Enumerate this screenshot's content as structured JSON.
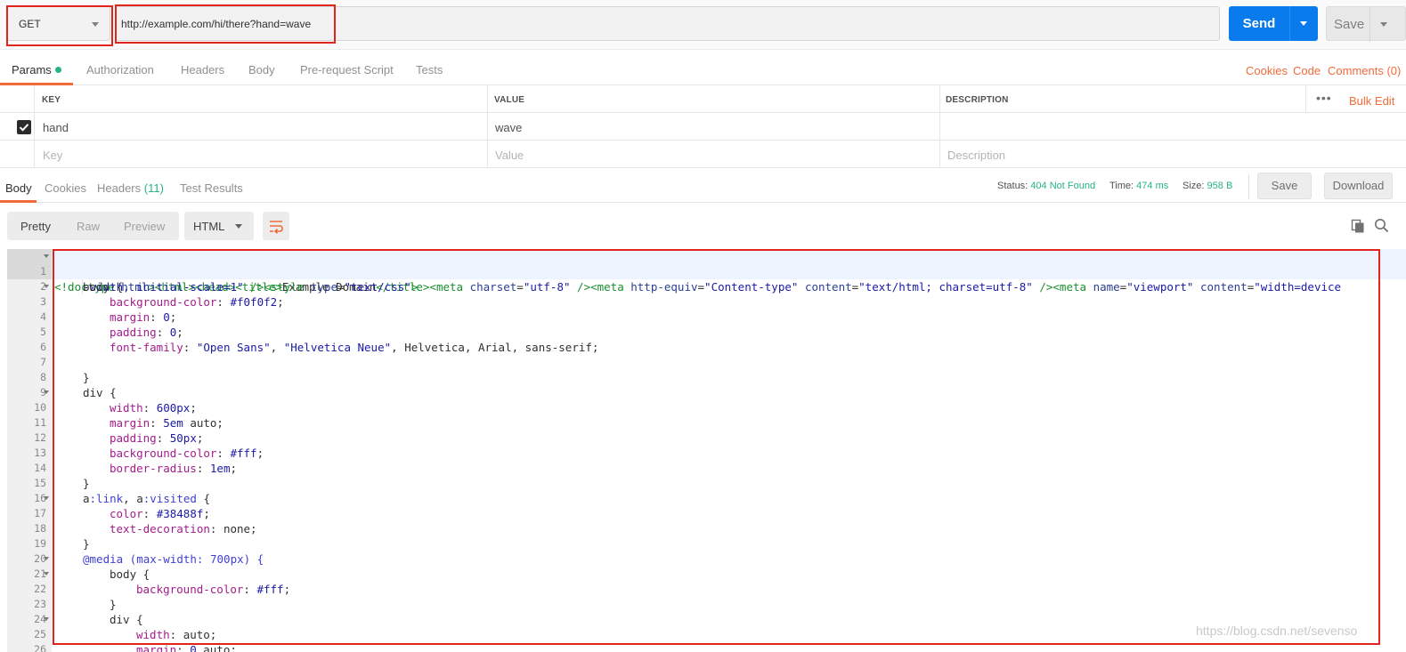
{
  "request": {
    "method": "GET",
    "url": "http://example.com/hi/there?hand=wave",
    "send_label": "Send",
    "save_label": "Save"
  },
  "request_tabs": {
    "params": "Params",
    "authorization": "Authorization",
    "headers": "Headers",
    "body": "Body",
    "prerequest": "Pre-request Script",
    "tests": "Tests",
    "cookies": "Cookies",
    "code": "Code",
    "comments": "Comments (0)"
  },
  "params": {
    "headers": {
      "key": "KEY",
      "value": "VALUE",
      "description": "DESCRIPTION"
    },
    "bulk_edit": "Bulk Edit",
    "more": "•••",
    "rows": [
      {
        "key": "hand",
        "value": "wave",
        "description": "",
        "enabled": true
      }
    ],
    "placeholders": {
      "key": "Key",
      "value": "Value",
      "description": "Description"
    }
  },
  "response_tabs": {
    "body": "Body",
    "cookies": "Cookies",
    "headers": "Headers",
    "headers_count": "(11)",
    "test_results": "Test Results"
  },
  "response_status": {
    "status_label": "Status:",
    "status_value": "404 Not Found",
    "time_label": "Time:",
    "time_value": "474 ms",
    "size_label": "Size:",
    "size_value": "958 B",
    "save_label": "Save",
    "download_label": "Download"
  },
  "view_modes": {
    "pretty": "Pretty",
    "raw": "Raw",
    "preview": "Preview",
    "format": "HTML"
  },
  "code": {
    "l1a": "<!doctype html><html><head><title>Example Domain</title><meta charset=\"utf-8\" /><meta http-equiv=\"Content-type\" content=\"text/html; charset=utf-8\" /><meta name=\"viewport\" content=\"width=device",
    "l1b": "-width, initial-scale=1\" /><style type=\"text/css\">",
    "l2": "body {",
    "l3": "background-color: #f0f0f2;",
    "l4": "margin: 0;",
    "l5": "padding: 0;",
    "l6": "font-family: \"Open Sans\", \"Helvetica Neue\", Helvetica, Arial, sans-serif;",
    "l8": "}",
    "l9": "div {",
    "l10": "width: 600px;",
    "l11": "margin: 5em auto;",
    "l12": "padding: 50px;",
    "l13": "background-color: #fff;",
    "l14": "border-radius: 1em;",
    "l15": "}",
    "l16": "a:link, a:visited {",
    "l17": "color: #38488f;",
    "l18": "text-decoration: none;",
    "l19": "}",
    "l20": "@media (max-width: 700px) {",
    "l21": "body {",
    "l22": "background-color: #fff;",
    "l23": "}",
    "l24": "div {",
    "l25": "width: auto;",
    "l26": "margin: 0 auto;"
  },
  "watermark": "https://blog.csdn.net/sevenso"
}
